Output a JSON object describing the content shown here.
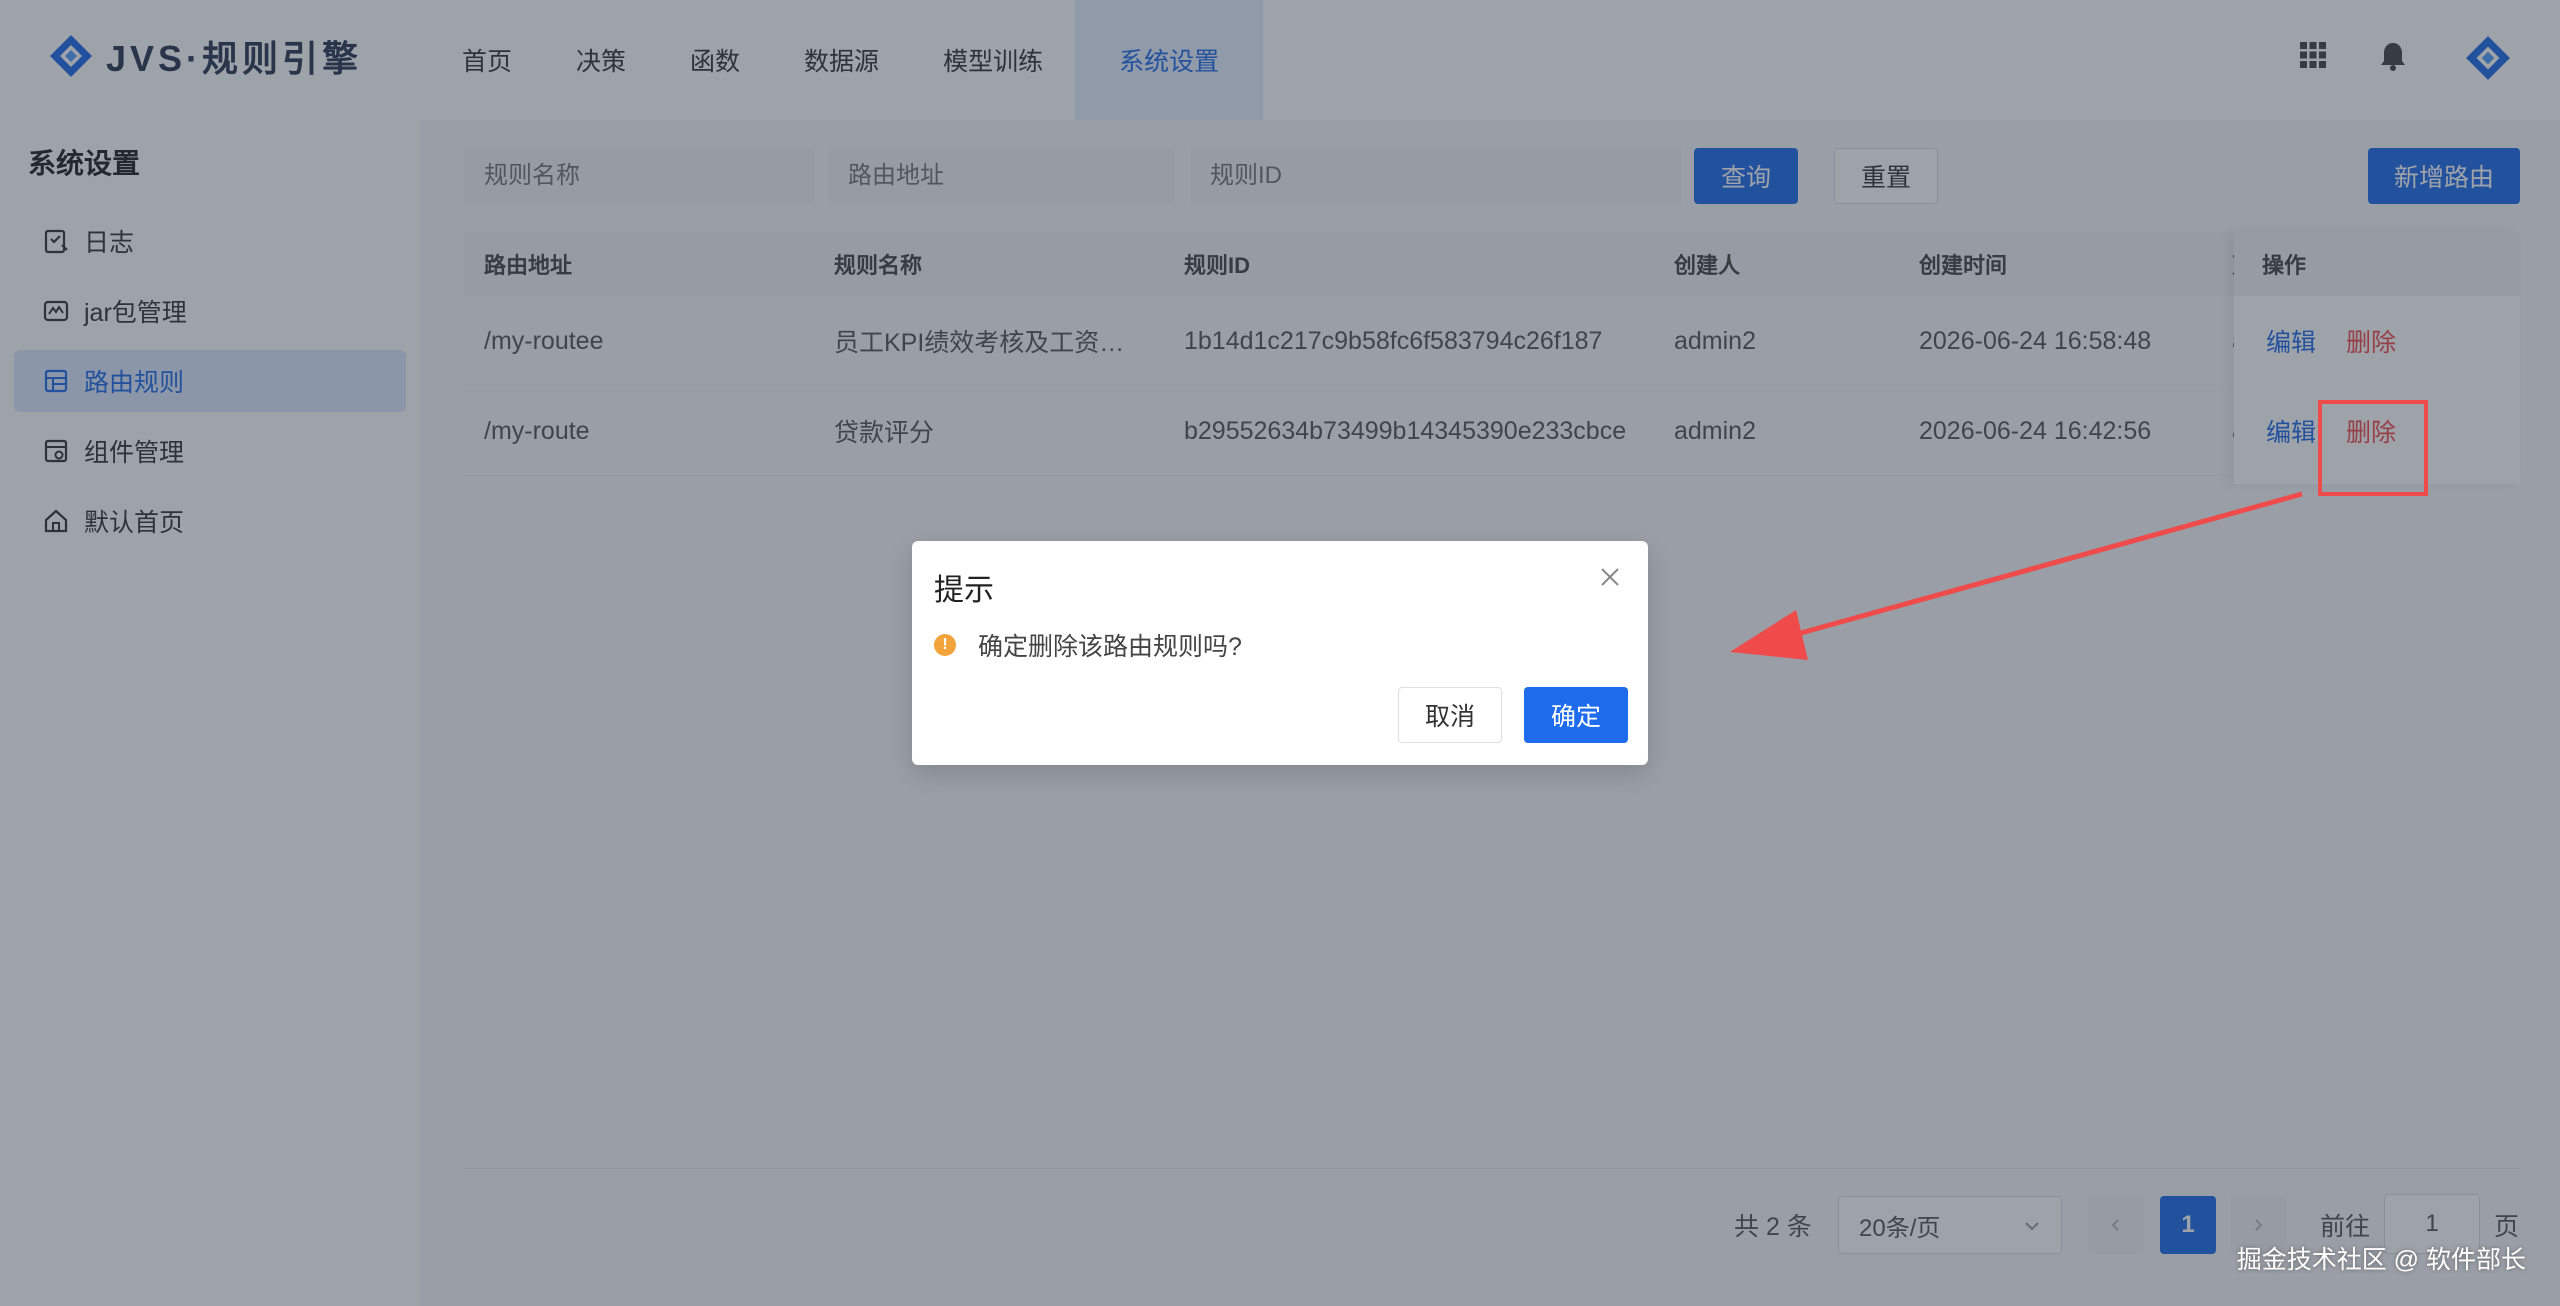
{
  "app": {
    "logo_text": "JVS·规则引擎"
  },
  "nav": {
    "items": [
      "首页",
      "决策",
      "函数",
      "数据源",
      "模型训练",
      "系统设置"
    ],
    "active": "系统设置"
  },
  "sidebar": {
    "title": "系统设置",
    "items": [
      {
        "label": "日志",
        "icon": "log-icon"
      },
      {
        "label": "jar包管理",
        "icon": "jar-icon"
      },
      {
        "label": "路由规则",
        "icon": "route-icon"
      },
      {
        "label": "组件管理",
        "icon": "component-icon"
      },
      {
        "label": "默认首页",
        "icon": "home-icon"
      }
    ],
    "active": "路由规则"
  },
  "search": {
    "rule_name_placeholder": "规则名称",
    "route_placeholder": "路由地址",
    "rule_id_placeholder": "规则ID",
    "query_label": "查询",
    "reset_label": "重置",
    "add_label": "新增路由"
  },
  "table": {
    "columns": [
      "路由地址",
      "规则名称",
      "规则ID",
      "创建人",
      "创建时间",
      "更",
      "操作"
    ],
    "rows": [
      {
        "route": "/my-routee",
        "name": "员工KPI绩效考核及工资…",
        "id": "1b14d1c217c9b58fc6f583794c26f187",
        "creator": "admin2",
        "created": "2026-06-24 16:58:48",
        "extra": "a"
      },
      {
        "route": "/my-route",
        "name": "贷款评分",
        "id": "b29552634b73499b14345390e233cbce",
        "creator": "admin2",
        "created": "2026-06-24 16:42:56",
        "extra": "a"
      }
    ],
    "edit_label": "编辑",
    "delete_label": "删除"
  },
  "pagination": {
    "total": "共 2 条",
    "page_size": "20条/页",
    "current_page": "1",
    "goto_label": "前往",
    "goto_value": "1",
    "page_suffix": "页"
  },
  "modal": {
    "title": "提示",
    "message": "确定删除该路由规则吗?",
    "cancel_label": "取消",
    "confirm_label": "确定"
  },
  "watermark": "掘金技术社区 @ 软件部长",
  "colors": {
    "primary": "#1e6ceb",
    "danger": "#f04b4b",
    "warning": "#f2a33a"
  }
}
